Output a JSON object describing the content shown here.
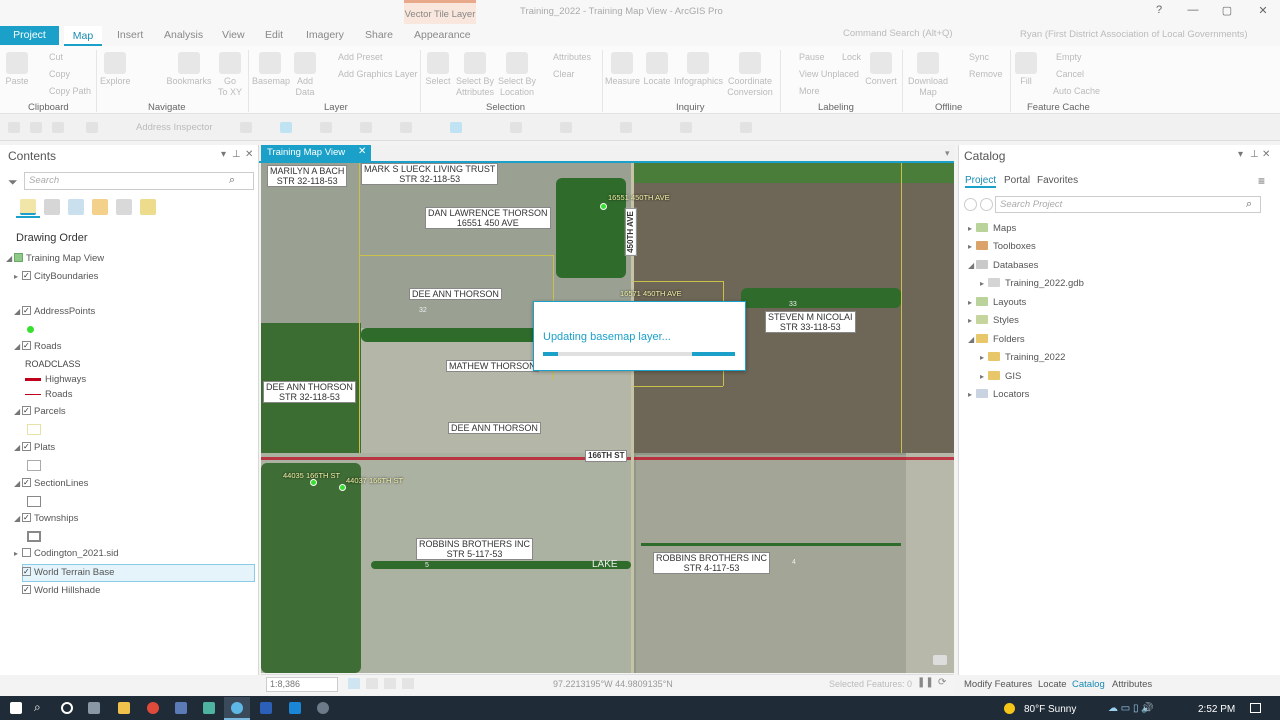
{
  "titlebar": {
    "contextual_tab": "Vector Tile Layer",
    "app_title": "Training_2022 - Training Map View - ArcGIS Pro",
    "command_search": "Command Search (Alt+Q)",
    "user": "Ryan (First District Association of Local Governments)",
    "help": "?",
    "minimize": "—",
    "maximize": "▢",
    "close": "✕"
  },
  "ribbon": {
    "tabs": [
      "Project",
      "Map",
      "Insert",
      "Analysis",
      "View",
      "Edit",
      "Imagery",
      "Share",
      "Appearance"
    ],
    "clipboard": {
      "paste": "Paste",
      "cut": "Cut",
      "copy": "Copy",
      "copy_path": "Copy Path",
      "group": "Clipboard"
    },
    "navigate": {
      "explore": "Explore",
      "bookmarks": "Bookmarks",
      "goto": "Go\nTo XY",
      "group": "Navigate"
    },
    "layer": {
      "basemap": "Basemap",
      "add_data": "Add\nData",
      "add_preset": "Add Preset",
      "add_graphics": "Add Graphics Layer",
      "group": "Layer"
    },
    "selection": {
      "select": "Select",
      "by_attr": "Select By\nAttributes",
      "by_loc": "Select By\nLocation",
      "attributes": "Attributes",
      "clear": "Clear",
      "group": "Selection"
    },
    "inquiry": {
      "measure": "Measure",
      "locate": "Locate",
      "infographics": "Infographics",
      "coord": "Coordinate\nConversion",
      "group": "Inquiry"
    },
    "labeling": {
      "pause": "Pause",
      "lock": "Lock",
      "view_unplaced": "View Unplaced",
      "more": "More",
      "convert": "Convert",
      "group": "Labeling"
    },
    "offline": {
      "download": "Download\nMap",
      "sync": "Sync",
      "remove": "Remove",
      "group": "Offline"
    },
    "cache": {
      "fill": "Fill",
      "empty": "Empty",
      "cancel": "Cancel",
      "auto": "Auto Cache",
      "group": "Feature Cache"
    },
    "address_inspector": "Address Inspector"
  },
  "contents": {
    "title": "Contents",
    "search_placeholder": "Search",
    "drawing_order": "Drawing Order",
    "layers": {
      "map_view": "Training Map View",
      "city": "CityBoundaries",
      "address": "AddressPoints",
      "roads": "Roads",
      "roadclass": "ROADCLASS",
      "highways": "Highways",
      "roads_sub": "Roads",
      "parcels": "Parcels",
      "plats": "Plats",
      "section": "SectionLines",
      "townships": "Townships",
      "codington": "Codington_2021.sid",
      "terrain": "World Terrain Base",
      "hillshade": "World Hillshade"
    }
  },
  "map_view": {
    "tab": "Training Map View",
    "labels": {
      "l1a": "MARILYN A BACH",
      "l1b": "STR 32-118-53",
      "l2a": "MARK S LUECK LIVING TRUST",
      "l2b": "STR 32-118-53",
      "l3a": "DAN LAWRENCE THORSON",
      "l3b": "16551 450 AVE",
      "l4": "DEE ANN THORSON",
      "l5": "MATHEW THORSON",
      "l6a": "DEE ANN THORSON",
      "l6b": "STR 32-118-53",
      "l7": "DEE ANN THORSON",
      "l8a": "STEVEN M NICOLAI",
      "l8b": "STR 33-118-53",
      "l9a": "ROBBINS BROTHERS INC",
      "l9b": "STR 5-117-53",
      "l10a": "ROBBINS BROTHERS INC",
      "l10b": "STR 4-117-53",
      "road_h": "166TH ST",
      "road_v": "450TH AVE",
      "lake": "LAKE",
      "a1": "16551 450TH AVE",
      "a2": "16571 450TH AVE",
      "a3": "44035 166TH ST",
      "a4": "44037 166TH ST",
      "n32": "32",
      "n33": "33",
      "n5": "5",
      "n4": "4"
    },
    "dialog": {
      "text": "Updating basemap layer...",
      "progress": 0.08
    },
    "scale": "1:8,386",
    "coords": "97.2213195°W 44.9809135°N",
    "selected": "Selected Features: 0"
  },
  "catalog": {
    "title": "Catalog",
    "tabs": [
      "Project",
      "Portal",
      "Favorites"
    ],
    "search_placeholder": "Search Project",
    "items": {
      "maps": "Maps",
      "toolboxes": "Toolboxes",
      "databases": "Databases",
      "gdb": "Training_2022.gdb",
      "layouts": "Layouts",
      "styles": "Styles",
      "folders": "Folders",
      "f1": "Training_2022",
      "f2": "GIS",
      "locators": "Locators"
    },
    "bottom_tabs": [
      "Modify Features",
      "Locate",
      "Catalog",
      "Attributes"
    ]
  },
  "taskbar": {
    "weather": "80°F  Sunny",
    "time": "2:52 PM"
  },
  "colors": {
    "accent": "#1ba1c9",
    "highway": "#c0001a",
    "point": "#36e02e"
  }
}
